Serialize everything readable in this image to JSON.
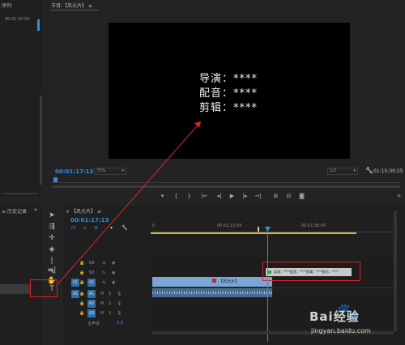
{
  "left_panel": {
    "title": "序列",
    "timecode": "00:01:20:00"
  },
  "program_monitor": {
    "tab_title": "节目:【风光片】",
    "credits": [
      "导演：****",
      "配音：****",
      "剪辑：****"
    ],
    "timecode": "00:01:17:13",
    "zoom": "75%",
    "resolution": "1/2",
    "duration": "01:15:30:25"
  },
  "history_panel": {
    "title": "历史记录"
  },
  "timeline": {
    "tab_title": "【风光片】",
    "timecode": "00:01:17:13",
    "ruler": [
      "0",
      "00:01:15:00",
      "00:01:30:00"
    ],
    "tracks": {
      "video": [
        "V3",
        "V2",
        "V1"
      ],
      "video_source": "V1",
      "audio": [
        "A1",
        "A2",
        "A3"
      ],
      "audio_source": "A1",
      "master": "主声道",
      "master_value": "0.0"
    },
    "clip_name": "【风光片】",
    "title_clip_text": "导演：****配音：****剪辑：****配乐：****"
  },
  "watermark": {
    "brand": "Bai经验",
    "url": "jingyan.baidu.com"
  },
  "colors": {
    "accent": "#2e8fe0",
    "highlight": "#e02020",
    "clip_blue": "#7aa5d6"
  }
}
